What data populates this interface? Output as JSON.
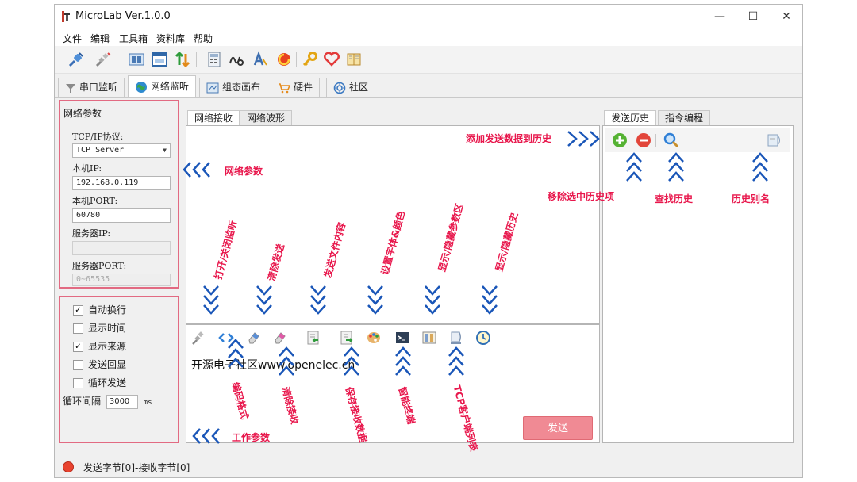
{
  "app": {
    "title": "MicroLab Ver.1.0.0"
  },
  "window_controls": {
    "minimize": "—",
    "maximize": "☐",
    "close": "✕"
  },
  "menu": [
    "文件",
    "编辑",
    "工具箱",
    "资料库",
    "帮助"
  ],
  "toolbar_icons": [
    "connect-icon",
    "disconnect-icon",
    "panel-icon",
    "window-icon",
    "transfer-icon",
    "calculator-icon",
    "chart-icon",
    "font-icon",
    "swirl-icon",
    "key-icon",
    "heart-icon",
    "book-icon"
  ],
  "main_tabs": [
    {
      "label": "串口监听",
      "icon": "funnel-icon"
    },
    {
      "label": "网络监听",
      "icon": "globe-icon"
    },
    {
      "label": "组态画布",
      "icon": "canvas-icon"
    },
    {
      "label": "硬件",
      "icon": "cart-icon"
    },
    {
      "label": "社区",
      "icon": "community-icon"
    }
  ],
  "net_params": {
    "group_title": "网络参数",
    "protocol_label": "TCP/IP协议:",
    "protocol_value": "TCP Server",
    "local_ip_label": "本机IP:",
    "local_ip_value": "192.168.0.119",
    "local_port_label": "本机PORT:",
    "local_port_value": "60780",
    "server_ip_label": "服务器IP:",
    "server_ip_value": "",
    "server_port_label": "服务器PORT:",
    "server_port_value": "0~65535"
  },
  "work_params": {
    "options": [
      {
        "label": "自动换行",
        "checked": true
      },
      {
        "label": "显示时间",
        "checked": false
      },
      {
        "label": "显示来源",
        "checked": true
      },
      {
        "label": "发送回显",
        "checked": false
      },
      {
        "label": "循环发送",
        "checked": false
      }
    ],
    "interval_label": "循环间隔",
    "interval_value": "3000",
    "interval_unit": "ms"
  },
  "center_tabs": [
    "网络接收",
    "网络波形"
  ],
  "send_area": {
    "text": "开源电子社区www.openelec.cn",
    "send_button": "发送"
  },
  "right_tabs": [
    "发送历史",
    "指令编程"
  ],
  "status": {
    "text": "发送字节[0]-接收字节[0]"
  },
  "annotations": {
    "net_params": "网络参数",
    "work_params": "工作参数",
    "add_history": "添加发送数据到历史",
    "remove_history": "移除选中历史项",
    "find_history": "查找历史",
    "history_alias": "历史别名",
    "open_close": "打开/关闭监听",
    "clear_send": "清除发送",
    "send_file": "发送文件内容",
    "set_font": "设置字体&颜色",
    "toggle_params": "显示/隐藏参数区",
    "toggle_history": "显示/隐藏历史",
    "encoding": "编码格式",
    "clear_recv": "清除接收",
    "save_recv": "保存接收数据",
    "smart_terminal": "智能终端",
    "tcp_clients": "TCP客户端列表"
  },
  "colors": {
    "annotation": "#e8174c",
    "box": "#e26a82",
    "send_button": "#f08a94",
    "status_dot": "#e8432f"
  }
}
